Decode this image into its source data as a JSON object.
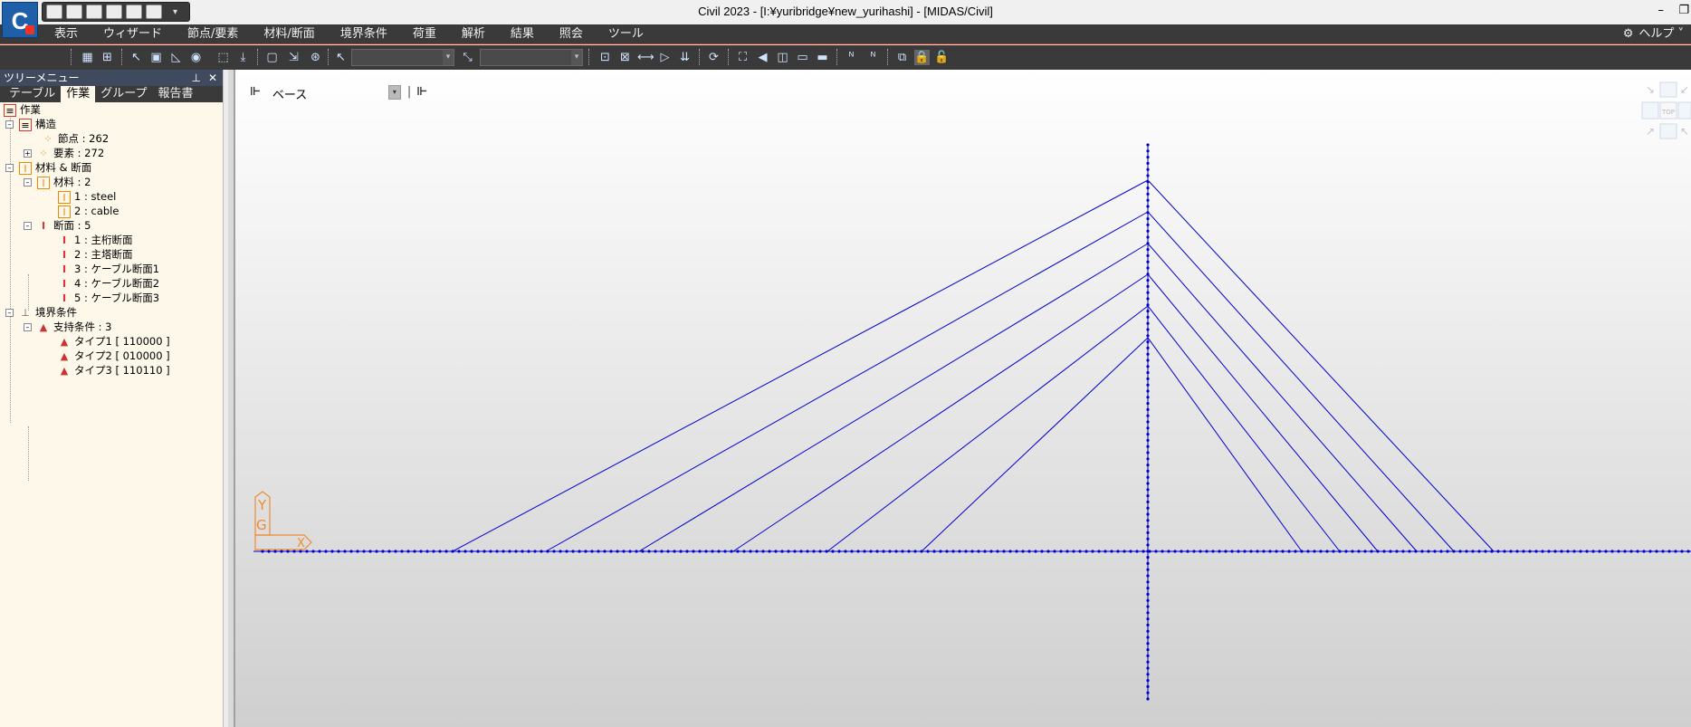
{
  "window": {
    "title": "Civil 2023 - [I:¥yuribridge¥new_yurihashi] - [MIDAS/Civil]",
    "logo_letter": "C"
  },
  "menu": {
    "items": [
      "表示",
      "ウィザード",
      "節点/要素",
      "材料/断面",
      "境界条件",
      "荷重",
      "解析",
      "結果",
      "照会",
      "ツール"
    ],
    "help": "ヘルプ"
  },
  "tree_panel": {
    "title": "ツリーメニュー",
    "tabs": [
      "テーブル",
      "作業",
      "グループ",
      "報告書"
    ],
    "active_tab": "作業",
    "root": "作業",
    "structure": {
      "label": "構造",
      "nodes": "節点 : 262",
      "elements": "要素 : 272"
    },
    "mat_sec": {
      "label": "材料 & 断面",
      "materials": {
        "label": "材料 : 2",
        "items": [
          "1 : steel",
          "2 : cable"
        ]
      },
      "sections": {
        "label": "断面 : 5",
        "items": [
          "1 : 主桁断面",
          "2 : 主塔断面",
          "3 : ケーブル断面1",
          "4 : ケーブル断面2",
          "5 : ケーブル断面3"
        ]
      }
    },
    "boundary": {
      "label": "境界条件",
      "supports": {
        "label": "支持条件 : 3",
        "items": [
          "タイプ1 [ 110000 ]",
          "タイプ2 [ 010000 ]",
          "タイプ3 [ 110110 ]"
        ]
      }
    }
  },
  "viewport": {
    "base_plane": "ベース",
    "model_color": "#0000cc",
    "axis_color": "#f08a30",
    "axis_labels": {
      "y": "Y",
      "g": "G",
      "x": "X"
    },
    "view_cube_label": "TOP"
  },
  "icons": {
    "gear": "gear-icon",
    "pin": "pin-icon",
    "close": "close-icon"
  }
}
